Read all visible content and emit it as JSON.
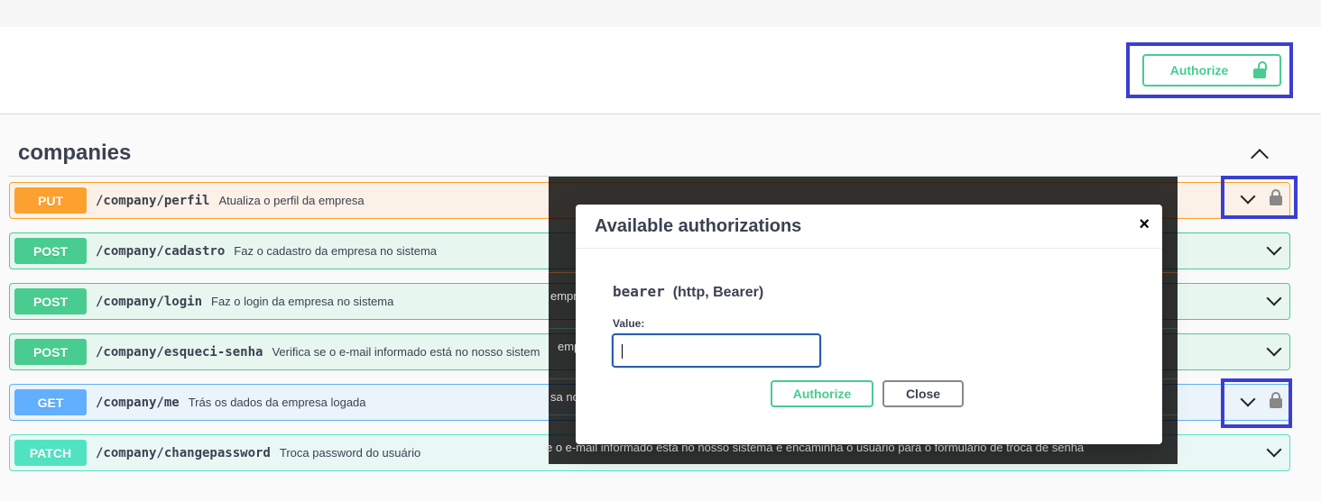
{
  "header": {
    "authorize_label": "Authorize"
  },
  "tag": {
    "name": "companies"
  },
  "operations": [
    {
      "method": "PUT",
      "path": "/company/perfil",
      "summary": "Atualiza o perfil da empresa",
      "secured": true
    },
    {
      "method": "POST",
      "path": "/company/cadastro",
      "summary": "Faz o cadastro da empresa no sistema",
      "secured": false
    },
    {
      "method": "POST",
      "path": "/company/login",
      "summary": "Faz o login da empresa no sistema",
      "secured": false
    },
    {
      "method": "POST",
      "path": "/company/esqueci-senha",
      "summary": "Verifica se o e-mail informado está no nosso sistem",
      "secured": false
    },
    {
      "method": "GET",
      "path": "/company/me",
      "summary": "Trás os dados da empresa logada",
      "secured": true
    },
    {
      "method": "PATCH",
      "path": "/company/changepassword",
      "summary": "Troca password do usuário",
      "secured": false
    }
  ],
  "overlay_bleed": {
    "row3": "empre",
    "row4": "emp",
    "row5": "sa no",
    "row6": "e o e-mail informado está no nosso sistema e encaminha o usuário para o formulário de troca de senha"
  },
  "modal": {
    "title": "Available authorizations",
    "close_glyph": "×",
    "scheme_name": "bearer",
    "scheme_type": "(http, Bearer)",
    "value_label": "Value:",
    "value_input": "",
    "authorize_label": "Authorize",
    "close_label": "Close"
  },
  "colors": {
    "put": "#fca130",
    "post": "#49cc90",
    "get": "#61affe",
    "patch": "#50e3c2",
    "highlight": "#3b3fd0"
  }
}
